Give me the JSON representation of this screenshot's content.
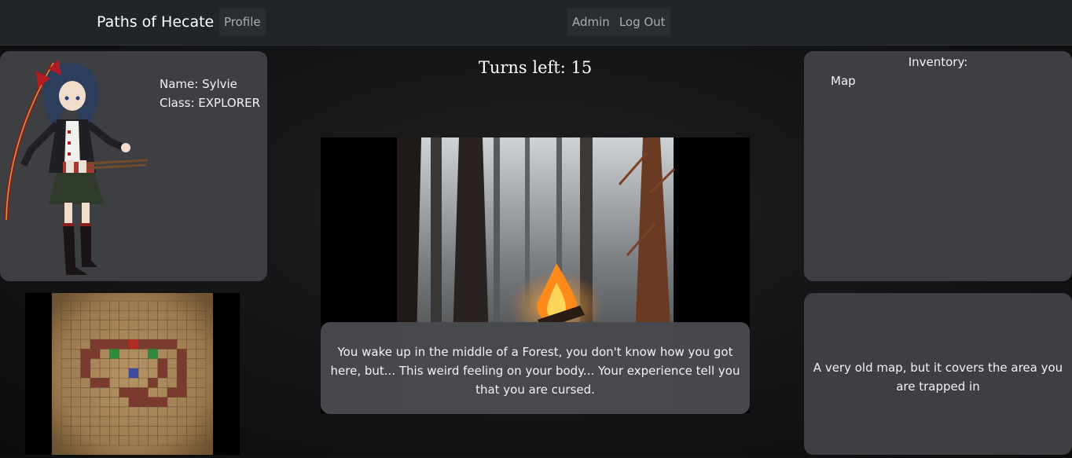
{
  "navbar": {
    "brand": "Paths of Hecate",
    "profile": "Profile",
    "admin": "Admin",
    "logout": "Log Out"
  },
  "character": {
    "name_line": "Name: Sylvie",
    "class_line": "Class: EXPLORER",
    "image_icon": "character-portrait"
  },
  "game": {
    "turns_label": "Turns left: 15",
    "scene_icon": "forest-campfire-scene",
    "story_text": "You wake up in the middle of a Forest, you don't know how you got here, but... This weird feeling on your body... Your experience tell you that you are cursed."
  },
  "inventory": {
    "title": "Inventory:",
    "items": [
      "Map"
    ]
  },
  "item_description": {
    "text": "A very old map, but it covers the area you are trapped in"
  },
  "minimap": {
    "icon": "grid-map",
    "grid_cells": 15,
    "colors": {
      "path": "#7a3b2e",
      "player": "#3f4a9e",
      "red_marker": "#b02a26",
      "green_marker": "#2e8b3e",
      "parchment": "#a8875a"
    }
  }
}
